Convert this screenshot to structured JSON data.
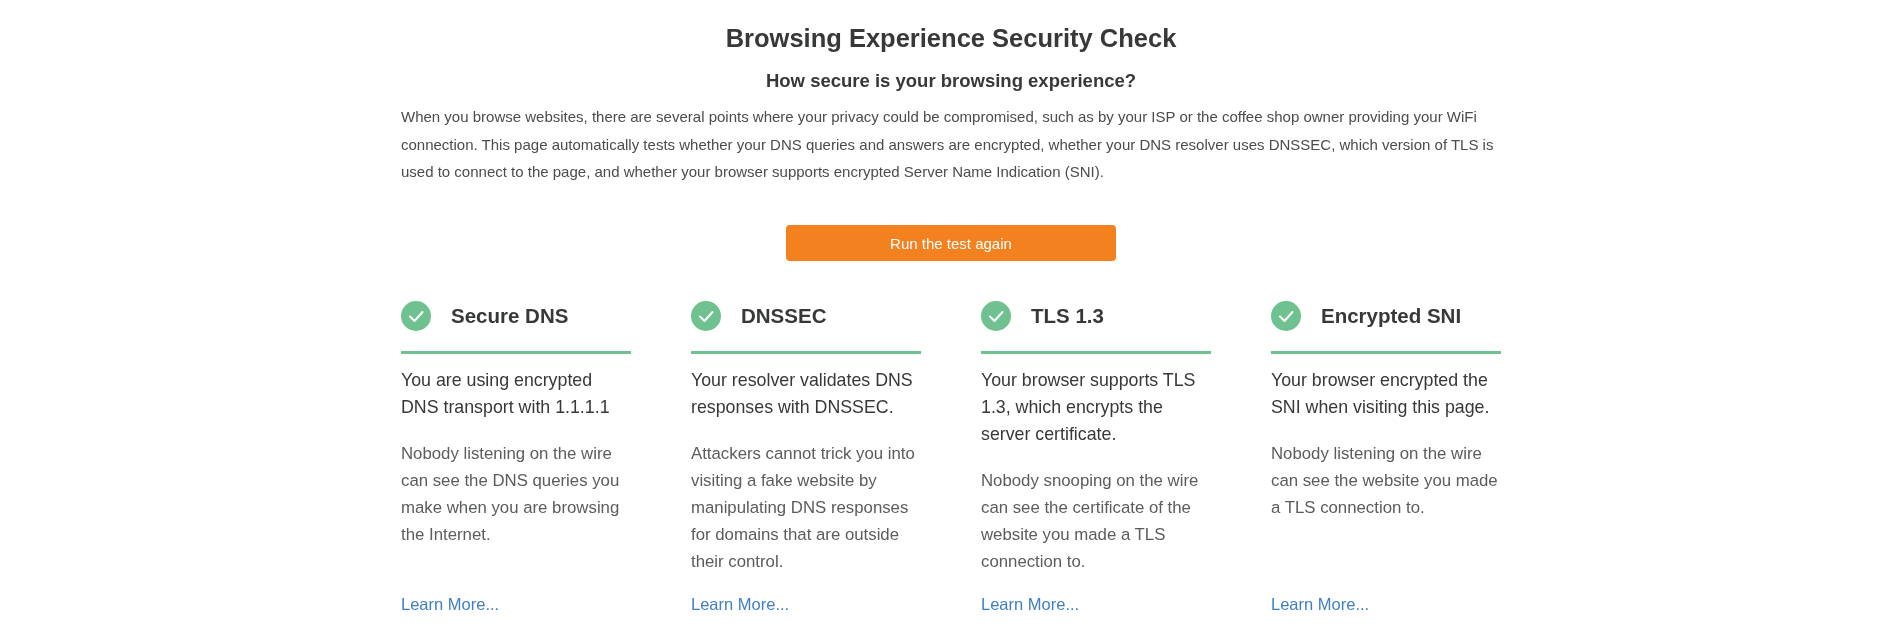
{
  "title": "Browsing Experience Security Check",
  "subtitle": "How secure is your browsing experience?",
  "intro": "When you browse websites, there are several points where your privacy could be compromised, such as by your ISP or the coffee shop owner providing your WiFi connection. This page automatically tests whether your DNS queries and answers are encrypted, whether your DNS resolver uses DNSSEC, which version of TLS is used to connect to the page, and whether your browser supports encrypted Server Name Indication (SNI).",
  "button": {
    "label": "Run the test again"
  },
  "checks": [
    {
      "title": "Secure DNS",
      "passed": true,
      "summary": "You are using encrypted DNS transport with 1.1.1.1",
      "detail": "Nobody listening on the wire can see the DNS queries you make when you are browsing the Internet.",
      "link": "Learn More..."
    },
    {
      "title": "DNSSEC",
      "passed": true,
      "summary": "Your resolver validates DNS responses with DNSSEC.",
      "detail": "Attackers cannot trick you into visiting a fake website by manipulating DNS responses for domains that are outside their control.",
      "link": "Learn More..."
    },
    {
      "title": "TLS 1.3",
      "passed": true,
      "summary": "Your browser supports TLS 1.3, which encrypts the server certificate.",
      "detail": "Nobody snooping on the wire can see the certificate of the website you made a TLS connection to.",
      "link": "Learn More..."
    },
    {
      "title": "Encrypted SNI",
      "passed": true,
      "summary": "Your browser encrypted the SNI when visiting this page.",
      "detail": "Nobody listening on the wire can see the website you made a TLS connection to.",
      "link": "Learn More..."
    }
  ]
}
